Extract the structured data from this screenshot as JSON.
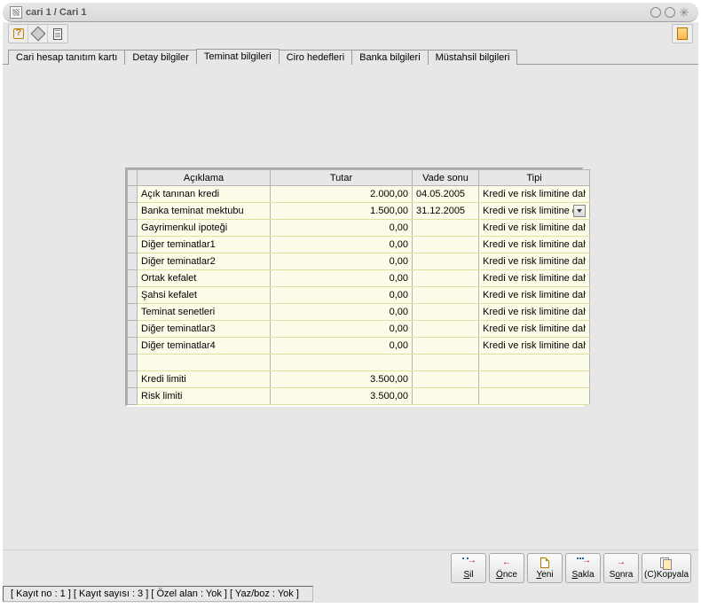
{
  "window": {
    "title": "cari 1 / Cari 1"
  },
  "tabs": {
    "items": [
      "Cari hesap tanıtım kartı",
      "Detay bilgiler",
      "Teminat bilgileri",
      "Ciro hedefleri",
      "Banka bilgileri",
      "Müstahsil bilgileri"
    ],
    "active_index": 2
  },
  "grid": {
    "headers": {
      "aciklama": "Açıklama",
      "tutar": "Tutar",
      "vade": "Vade sonu",
      "tipi": "Tipi"
    },
    "rows": [
      {
        "aciklama": "Açık tanınan kredi",
        "tutar": "2.000,00",
        "vade": "04.05.2005",
        "tipi": "Kredi ve risk limitine dahil",
        "selected": false
      },
      {
        "aciklama": "Banka teminat mektubu",
        "tutar": "1.500,00",
        "vade": "31.12.2005",
        "tipi": "Kredi ve risk limitine da",
        "selected": true
      },
      {
        "aciklama": "Gayrimenkul ipoteği",
        "tutar": "0,00",
        "vade": "",
        "tipi": "Kredi ve risk limitine dahil",
        "selected": false
      },
      {
        "aciklama": "Diğer teminatlar1",
        "tutar": "0,00",
        "vade": "",
        "tipi": "Kredi ve risk limitine dahil",
        "selected": false
      },
      {
        "aciklama": "Diğer teminatlar2",
        "tutar": "0,00",
        "vade": "",
        "tipi": "Kredi ve risk limitine dahil",
        "selected": false
      },
      {
        "aciklama": "Ortak kefalet",
        "tutar": "0,00",
        "vade": "",
        "tipi": "Kredi ve risk limitine dahil",
        "selected": false
      },
      {
        "aciklama": "Şahsi kefalet",
        "tutar": "0,00",
        "vade": "",
        "tipi": "Kredi ve risk limitine dahil",
        "selected": false
      },
      {
        "aciklama": "Teminat senetleri",
        "tutar": "0,00",
        "vade": "",
        "tipi": "Kredi ve risk limitine dahil",
        "selected": false
      },
      {
        "aciklama": "Diğer teminatlar3",
        "tutar": "0,00",
        "vade": "",
        "tipi": "Kredi ve risk limitine dahil",
        "selected": false
      },
      {
        "aciklama": "Diğer teminatlar4",
        "tutar": "0,00",
        "vade": "",
        "tipi": "Kredi ve risk limitine dahil",
        "selected": false
      }
    ],
    "blank_rows": 1,
    "totals": [
      {
        "aciklama": "Kredi limiti",
        "tutar": "3.500,00"
      },
      {
        "aciklama": "Risk limiti",
        "tutar": "3.500,00"
      }
    ]
  },
  "buttons": {
    "sil": "Sil",
    "once": "Önce",
    "yeni": "Yeni",
    "sakla": "Sakla",
    "sonra": "Sonra",
    "kopyala": "(C)Kopyala"
  },
  "status": "[ Kayıt no : 1 ] [ Kayıt sayısı : 3 ] [ Özel alan : Yok ] [ Yaz/boz : Yok ]"
}
